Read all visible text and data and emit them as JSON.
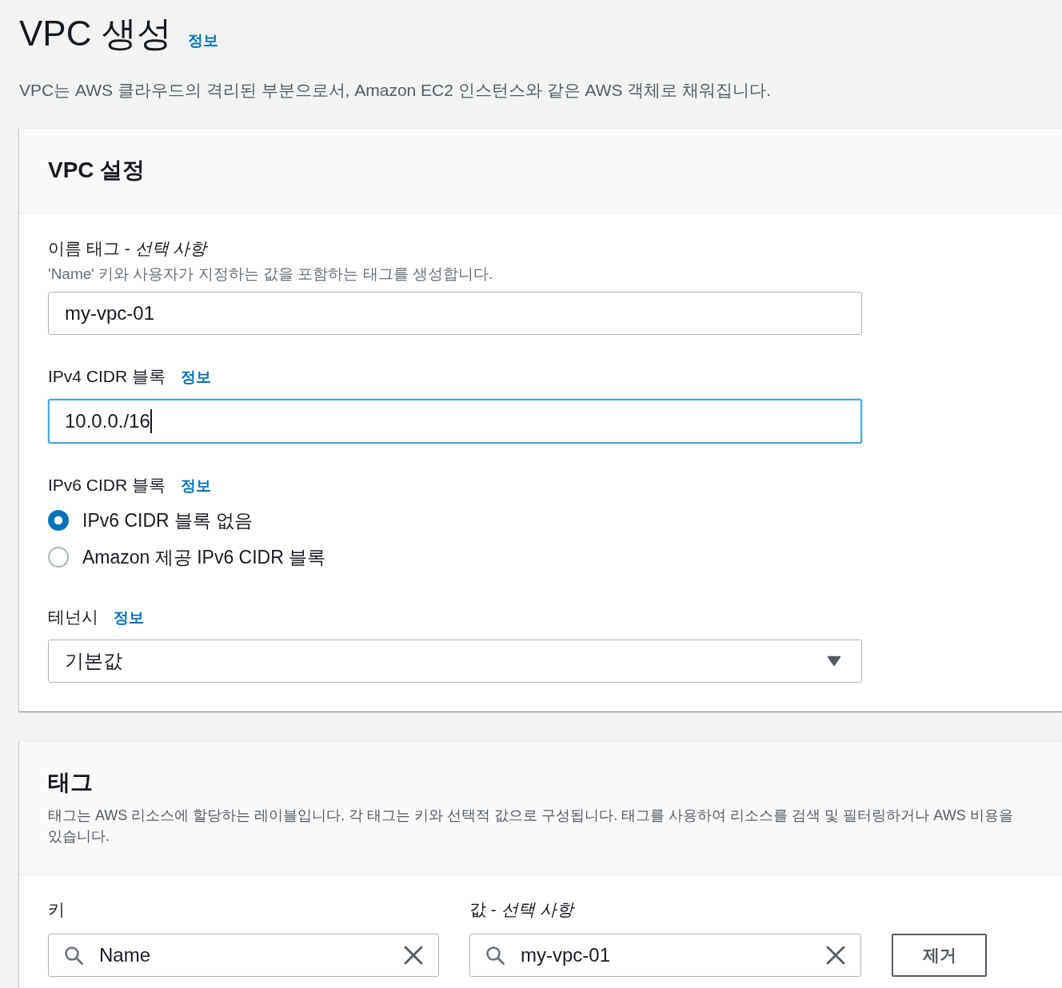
{
  "page_header": {
    "title": "VPC 생성",
    "info_link": "정보",
    "description": "VPC는 AWS 클라우드의 격리된 부분으로서, Amazon EC2 인스턴스와 같은 AWS 객체로 채워집니다."
  },
  "vpc_settings": {
    "title": "VPC 설정",
    "fields": [
      {
        "kind": "text",
        "label": "이름 태그 - *선택 사항*",
        "hint": "'Name' 키와 사용자가 지정하는 값을 포함하는 태그를 생성합니다.",
        "value": "my-vpc-01",
        "focused": false
      },
      {
        "kind": "text",
        "label": "IPv4 CIDR 블록",
        "info_link": "정보",
        "value": "10.0.0./16",
        "focused": true
      },
      {
        "kind": "radio",
        "label": "IPv6 CIDR 블록",
        "info_link": "정보",
        "options": [
          {
            "label": "IPv6 CIDR 블록 없음",
            "selected": true
          },
          {
            "label": "Amazon 제공 IPv6 CIDR 블록",
            "selected": false
          }
        ]
      },
      {
        "kind": "select",
        "label": "테넌시",
        "info_link": "정보",
        "value": "기본값"
      }
    ]
  },
  "tags": {
    "title": "태그",
    "description_lines": [
      "태그는 AWS 리소스에 할당하는 레이블입니다. 각 태그는 키와 선택적 값으로 구성됩니다. 태그를 사용하여 리소스를 검색 및 필터링하거나 AWS 비용을",
      "있습니다."
    ],
    "key_label": "키",
    "value_label": "값 - *선택 사항*",
    "rows": [
      {
        "key": "Name",
        "value": "my-vpc-01",
        "remove_button": "제거"
      }
    ]
  }
}
